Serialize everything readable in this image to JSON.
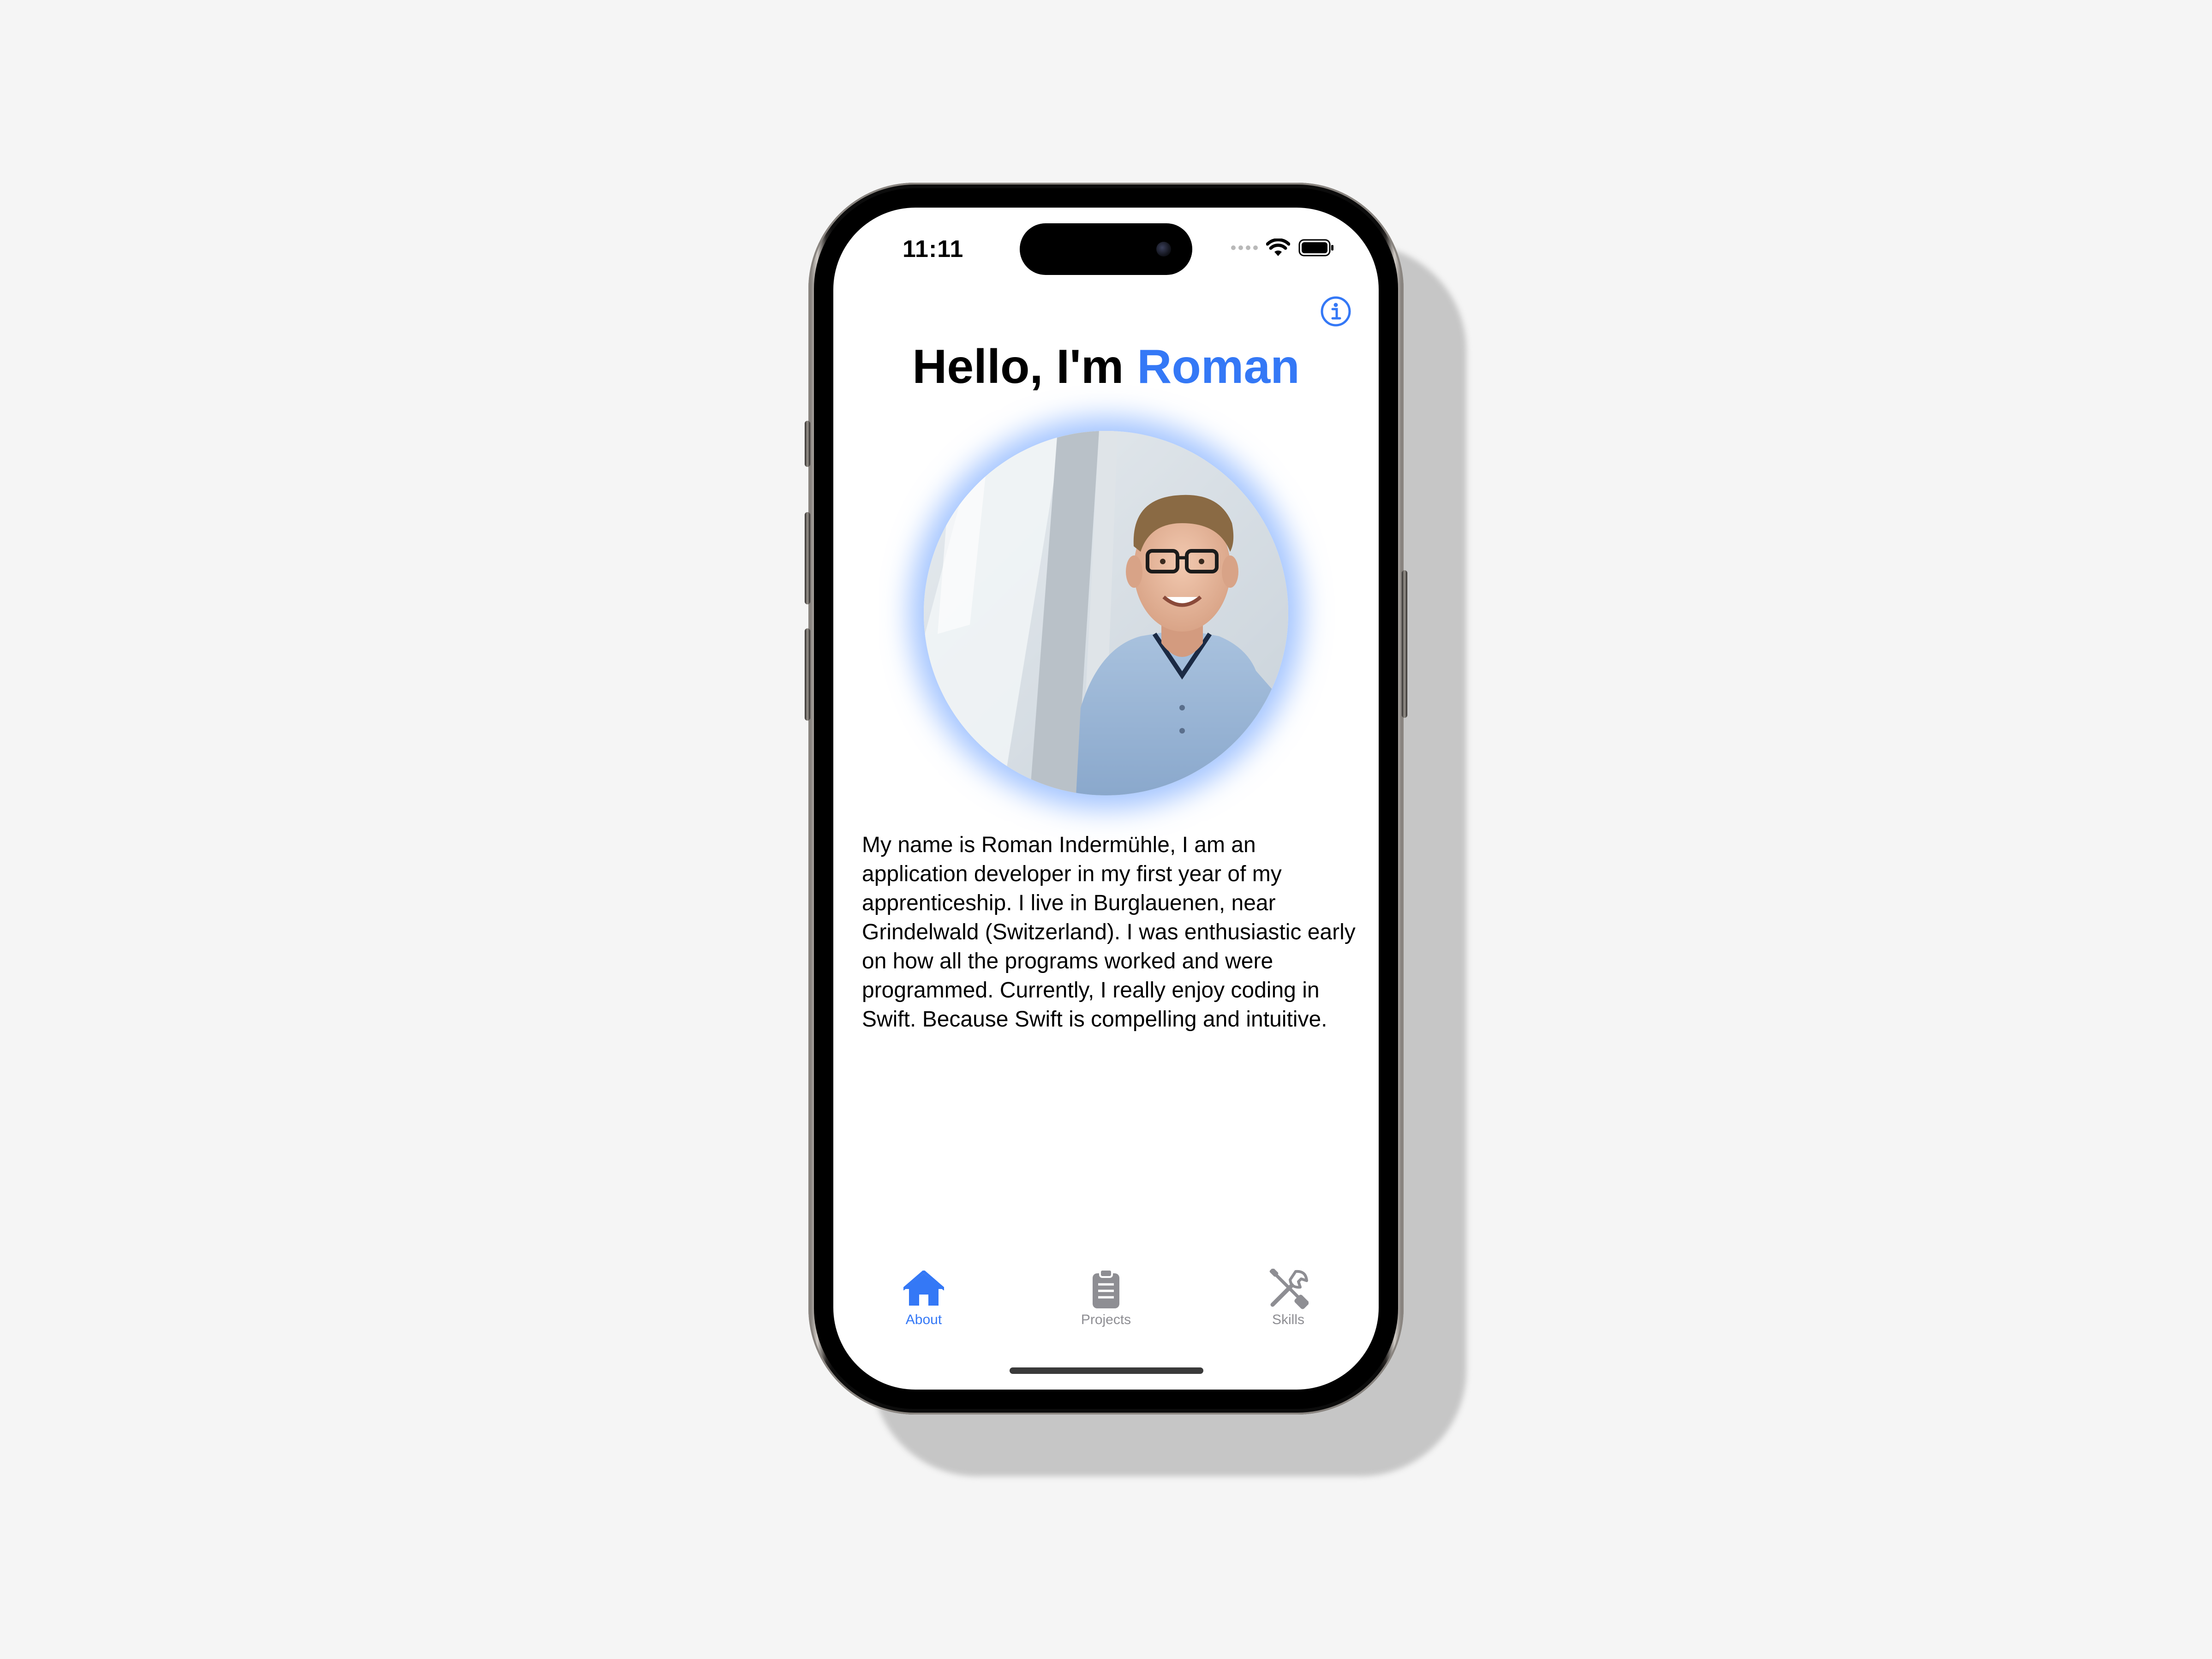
{
  "status_bar": {
    "time": "11:11",
    "wifi_icon": "wifi-icon",
    "battery_icon": "battery-icon"
  },
  "header": {
    "info_icon": "info-circle-icon",
    "title_prefix": "Hello, I'm ",
    "title_name": "Roman"
  },
  "profile": {
    "photo": "profile-photo"
  },
  "bio": {
    "text": "My name is Roman Indermühle, I am an application developer in my first year of my apprenticeship. I live in Burglauenen, near Grindelwald (Switzerland). I was enthusiastic early on how all the programs worked and were programmed. Currently, I really enjoy coding in Swift. Because Swift is compelling and intuitive."
  },
  "tabbar": {
    "tabs": [
      {
        "label": "About",
        "icon": "house-icon",
        "active": true
      },
      {
        "label": "Projects",
        "icon": "clipboard-icon",
        "active": false
      },
      {
        "label": "Skills",
        "icon": "wrench-screwdriver-icon",
        "active": false
      }
    ]
  },
  "colors": {
    "accent": "#3478f6",
    "inactive": "#8e8e93",
    "background": "#f5f5f5"
  }
}
